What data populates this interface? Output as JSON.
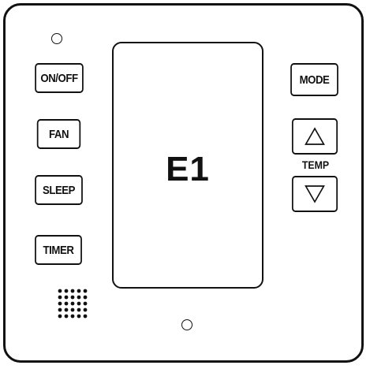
{
  "device": {
    "left_buttons": {
      "onoff_label": "ON/OFF",
      "fan_label": "FAN",
      "sleep_label": "SLEEP",
      "timer_label": "TIMER"
    },
    "right_buttons": {
      "mode_label": "MODE",
      "temp_label": "TEMP",
      "up_icon": "triangle-up-icon",
      "down_icon": "triangle-down-icon"
    },
    "display": {
      "code": "E1"
    },
    "indicators": {
      "top_led": "led-indicator",
      "bottom_led": "led-indicator",
      "speaker": "speaker-grille-icon"
    },
    "colors": {
      "outline": "#111111",
      "background": "#ffffff"
    }
  }
}
